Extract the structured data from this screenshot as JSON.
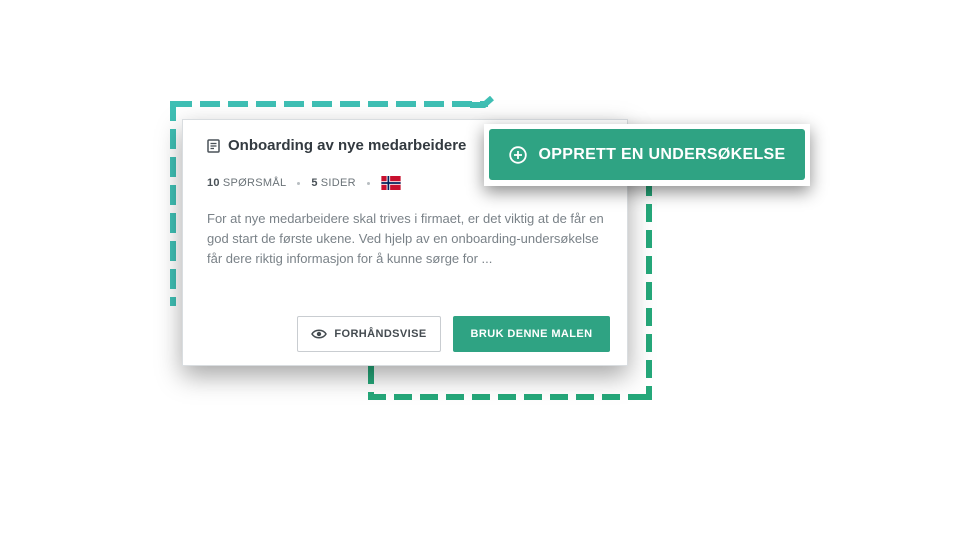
{
  "card": {
    "title": "Onboarding av nye medarbeidere",
    "title_icon": "document-icon",
    "questions_count": "10",
    "questions_label": "SPØRSMÅL",
    "pages_count": "5",
    "pages_label": "SIDER",
    "language_flag": "norway-flag-icon",
    "description": "For at nye medarbeidere skal trives i firmaet, er det viktig at de får en god start de første ukene. Ved hjelp av en onboarding-undersøkelse får dere riktig informasjon for å kunne sørge for ...",
    "preview_label": "FORHÅNDSVISE",
    "preview_icon": "eye-icon",
    "use_label": "BRUK DENNE MALEN"
  },
  "cta": {
    "label": "OPPRETT EN UNDERSØKELSE",
    "icon": "plus-circle-icon"
  },
  "colors": {
    "primary_green": "#2fa383",
    "teal_dash": "#3fbfb4",
    "green_dash": "#25a87a",
    "title_text": "#333a40",
    "body_text": "#7a8288"
  }
}
